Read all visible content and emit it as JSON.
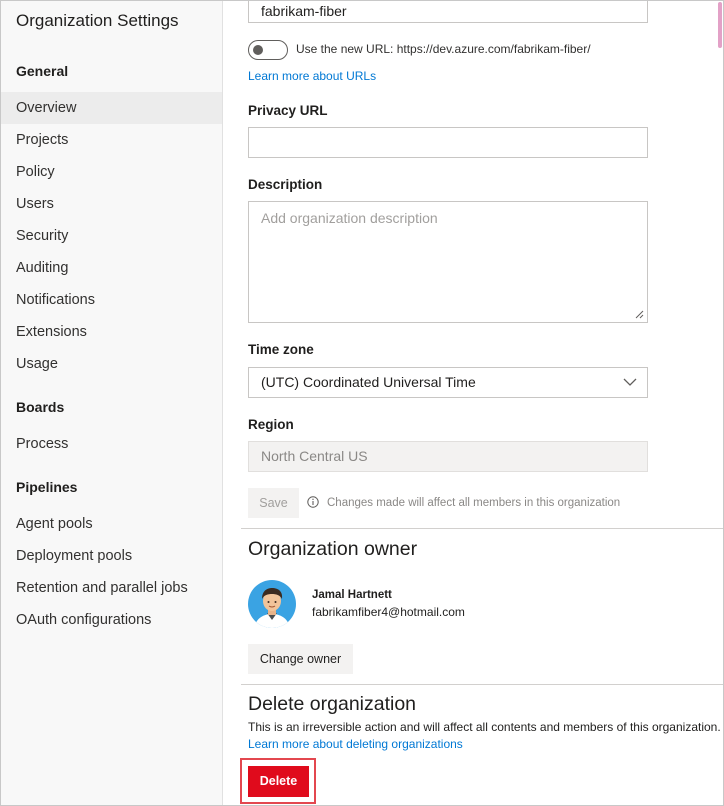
{
  "sidebar": {
    "title": "Organization Settings",
    "groups": [
      {
        "label": "General",
        "items": [
          "Overview",
          "Projects",
          "Policy",
          "Users",
          "Security",
          "Auditing",
          "Notifications",
          "Extensions",
          "Usage"
        ]
      },
      {
        "label": "Boards",
        "items": [
          "Process"
        ]
      },
      {
        "label": "Pipelines",
        "items": [
          "Agent pools",
          "Deployment pools",
          "Retention and parallel jobs",
          "OAuth configurations"
        ]
      }
    ],
    "selected": "Overview"
  },
  "form": {
    "name_value": "fabrikam-fiber",
    "new_url_toggle_label": "Use the new URL: https://dev.azure.com/fabrikam-fiber/",
    "new_url_toggle_on": false,
    "learn_urls_link": "Learn more about URLs",
    "privacy_label": "Privacy URL",
    "privacy_value": "",
    "description_label": "Description",
    "description_placeholder": "Add organization description",
    "timezone_label": "Time zone",
    "timezone_value": "(UTC) Coordinated Universal Time",
    "region_label": "Region",
    "region_value": "North Central US",
    "save_label": "Save",
    "save_note": "Changes made will affect all members in this organization"
  },
  "owner": {
    "section_title": "Organization owner",
    "name": "Jamal Hartnett",
    "email": "fabrikamfiber4@hotmail.com",
    "change_owner_label": "Change owner"
  },
  "delete": {
    "section_title": "Delete organization",
    "description": "This is an irreversible action and will affect all contents and members of this organization.",
    "learn_link": "Learn more about deleting organizations",
    "delete_label": "Delete"
  },
  "colors": {
    "accent": "#0078d4",
    "danger": "#e00b1c",
    "highlight": "#e3474f"
  }
}
